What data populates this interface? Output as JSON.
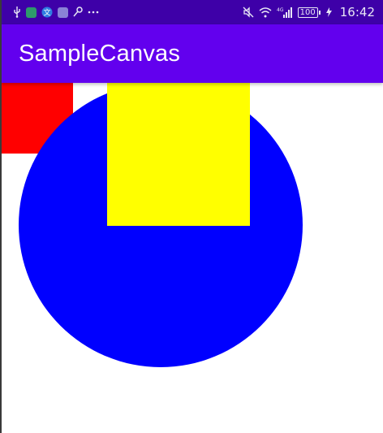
{
  "status_bar": {
    "time": "16:42",
    "battery": "100",
    "network": "4G",
    "left_icons": [
      "usb-icon",
      "app-icon-green",
      "translate-icon",
      "app-icon-purple",
      "key-icon",
      "more-dots-icon"
    ],
    "right_icons": [
      "mute-icon",
      "wifi-icon",
      "signal-icon",
      "battery-icon",
      "charging-icon"
    ]
  },
  "app_bar": {
    "title": "SampleCanvas",
    "color": "#6200ee"
  },
  "canvas": {
    "shapes": {
      "red_square": {
        "color": "#ff0000"
      },
      "blue_circle": {
        "color": "#0000ff"
      },
      "yellow_square": {
        "color": "#ffff00"
      }
    }
  }
}
